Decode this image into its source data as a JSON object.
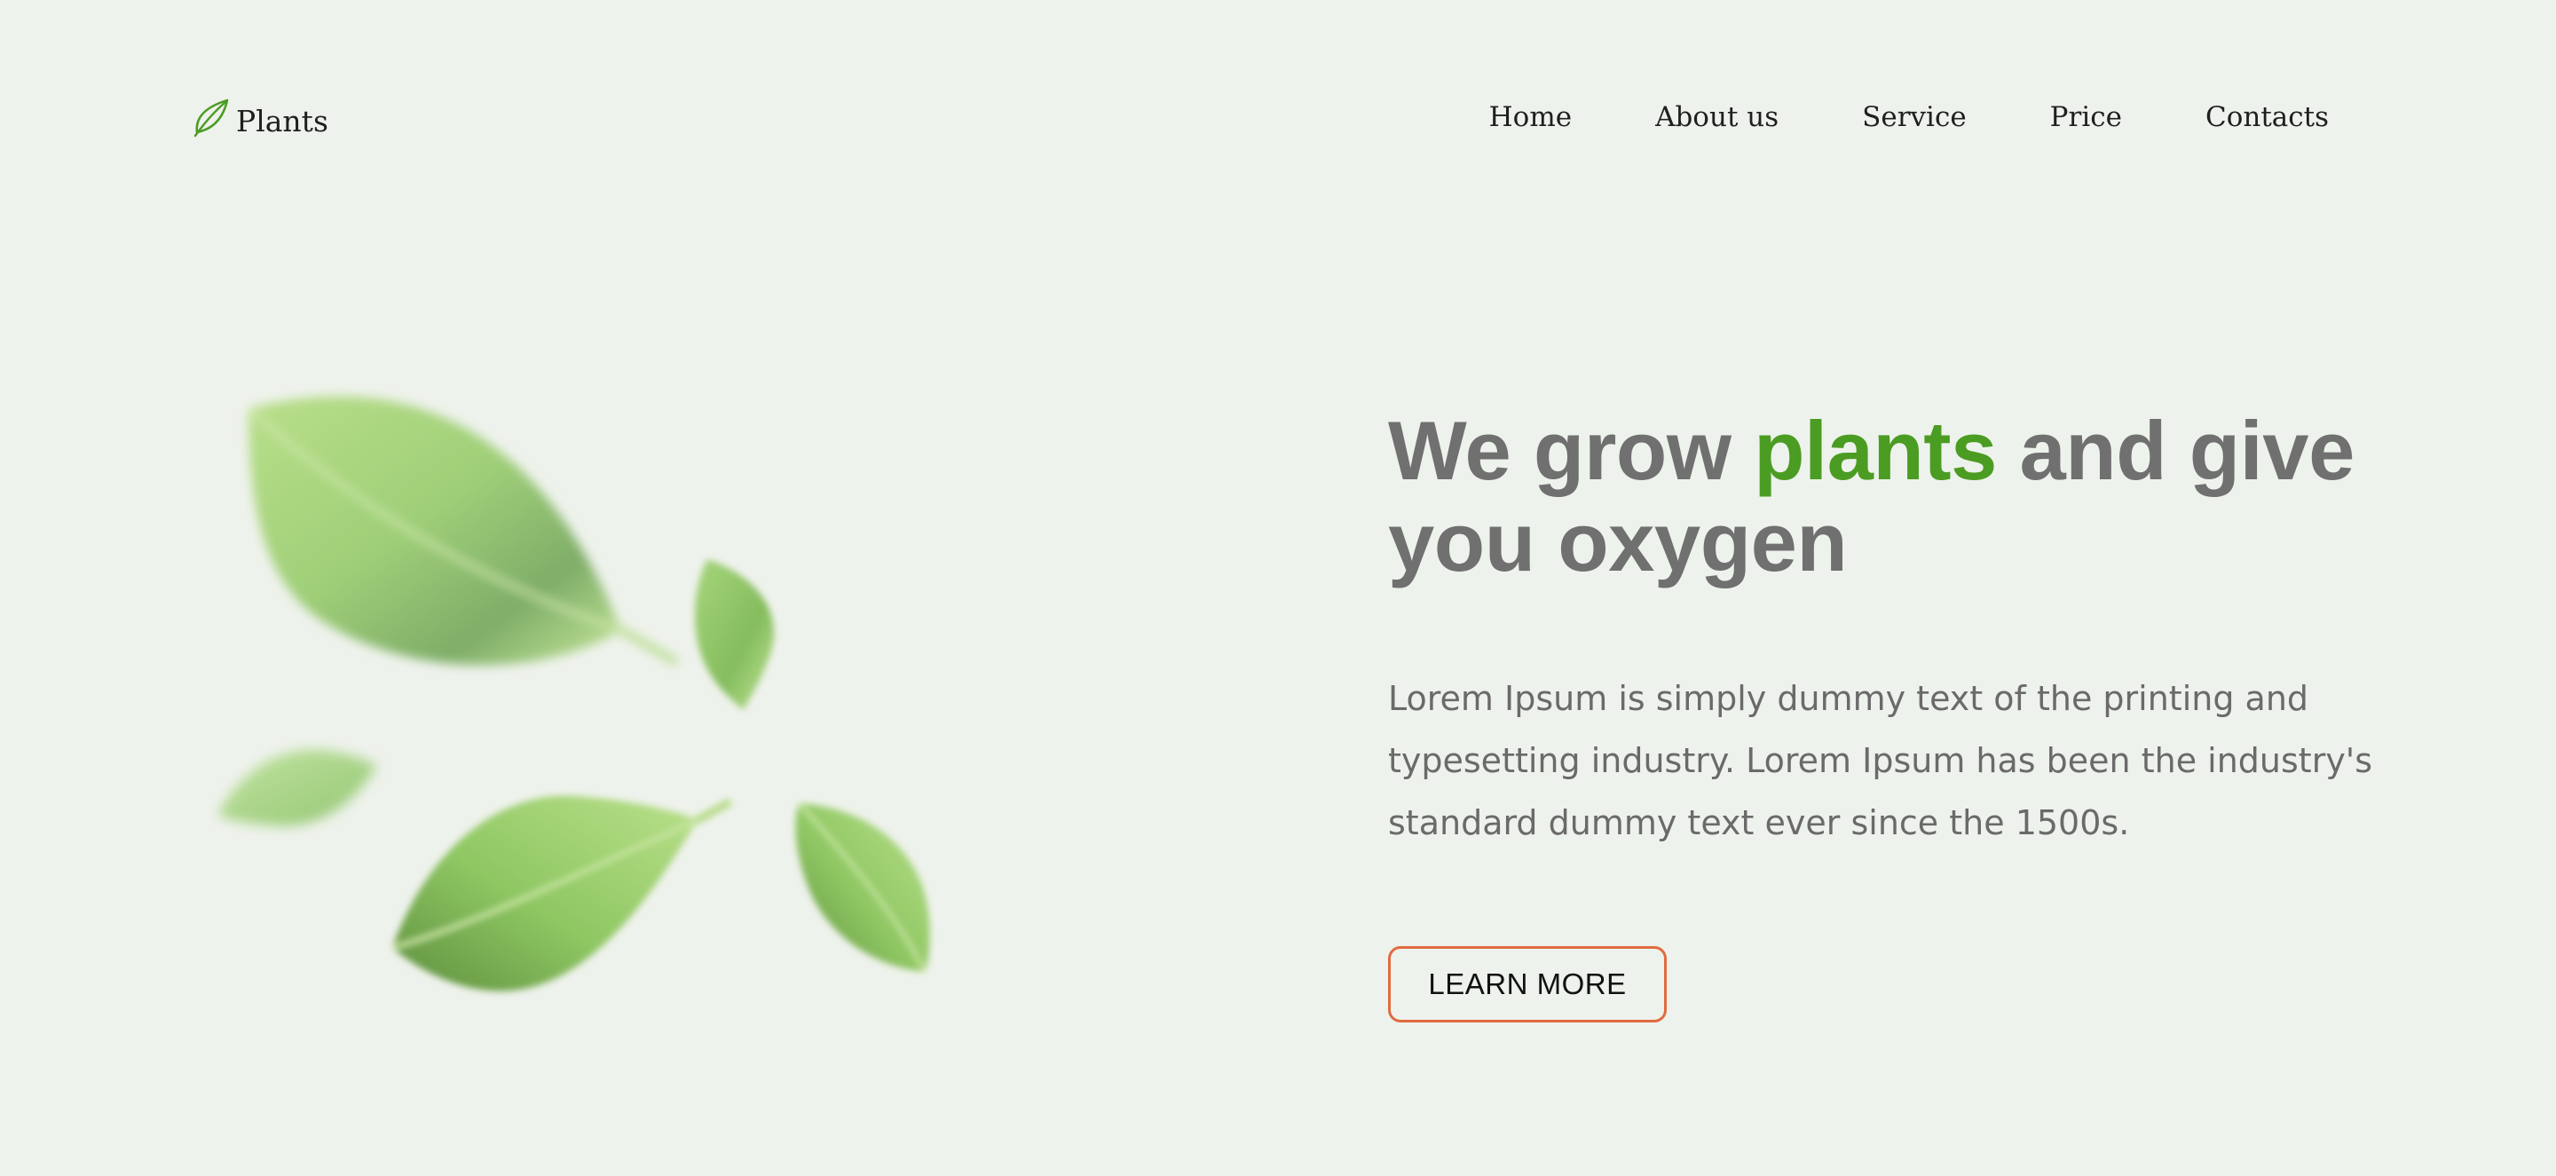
{
  "brand": {
    "name": "Plants",
    "logo_icon": "leaf-icon",
    "accent_color": "#4b9c22"
  },
  "nav": {
    "items": [
      {
        "label": "Home"
      },
      {
        "label": "About us"
      },
      {
        "label": "Service"
      },
      {
        "label": "Price"
      },
      {
        "label": "Contacts"
      }
    ]
  },
  "hero": {
    "title_before": "We grow ",
    "title_accent": "plants",
    "title_after": " and give you oxygen",
    "description": "Lorem Ipsum is simply dummy text of the printing and typesetting industry. Lorem Ipsum has been the industry's standard dummy text ever since the 1500s.",
    "button_label": "LEARN MORE",
    "button_border_color": "#e06b3f"
  },
  "illustration": {
    "icon": "falling-leaves-illustration"
  }
}
